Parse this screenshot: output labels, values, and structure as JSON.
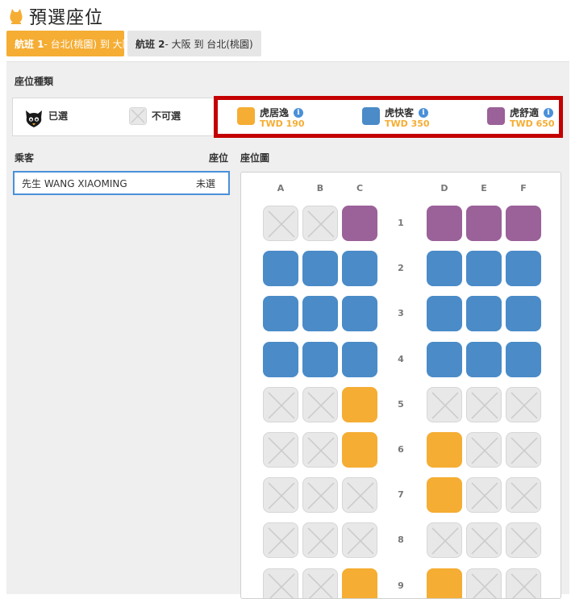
{
  "header": {
    "title": "預選座位",
    "icon": "tiger-icon"
  },
  "tabs": [
    {
      "label_bold": "航班 1",
      "label_rest": " - 台北(桃園) 到 大阪",
      "active": true
    },
    {
      "label_bold": "航班 2",
      "label_rest": " - 大阪 到 台北(桃園)",
      "active": false
    }
  ],
  "seat_types": {
    "title": "座位種類",
    "selected_label": "已選",
    "unavailable_label": "不可選",
    "fares": [
      {
        "name": "虎居逸",
        "price": "TWD 190",
        "color": "#f5ad33"
      },
      {
        "name": "虎快客",
        "price": "TWD 350",
        "color": "#4a8bc8"
      },
      {
        "name": "虎舒適",
        "price": "TWD 650",
        "color": "#9b6199"
      }
    ]
  },
  "columns": {
    "passenger": "乘客",
    "seat": "座位",
    "seat_map": "座位圖"
  },
  "passenger": {
    "name": "先生 WANG XIAOMING",
    "seat": "未選"
  },
  "seat_map": {
    "columns": [
      "A",
      "B",
      "C",
      "D",
      "E",
      "F"
    ],
    "rows": [
      {
        "num": "1",
        "seats": [
          "x",
          "x",
          "purple",
          "purple",
          "purple",
          "purple"
        ]
      },
      {
        "num": "2",
        "seats": [
          "blue",
          "blue",
          "blue",
          "blue",
          "blue",
          "blue"
        ]
      },
      {
        "num": "3",
        "seats": [
          "blue",
          "blue",
          "blue",
          "blue",
          "blue",
          "blue"
        ]
      },
      {
        "num": "4",
        "seats": [
          "blue",
          "blue",
          "blue",
          "blue",
          "blue",
          "blue"
        ]
      },
      {
        "num": "5",
        "seats": [
          "x",
          "x",
          "orange",
          "x",
          "x",
          "x"
        ]
      },
      {
        "num": "6",
        "seats": [
          "x",
          "x",
          "orange",
          "orange",
          "x",
          "x"
        ]
      },
      {
        "num": "7",
        "seats": [
          "x",
          "x",
          "x",
          "orange",
          "x",
          "x"
        ]
      },
      {
        "num": "8",
        "seats": [
          "x",
          "x",
          "x",
          "x",
          "x",
          "x"
        ]
      },
      {
        "num": "9",
        "seats": [
          "x",
          "x",
          "orange",
          "orange",
          "x",
          "x"
        ]
      }
    ]
  }
}
